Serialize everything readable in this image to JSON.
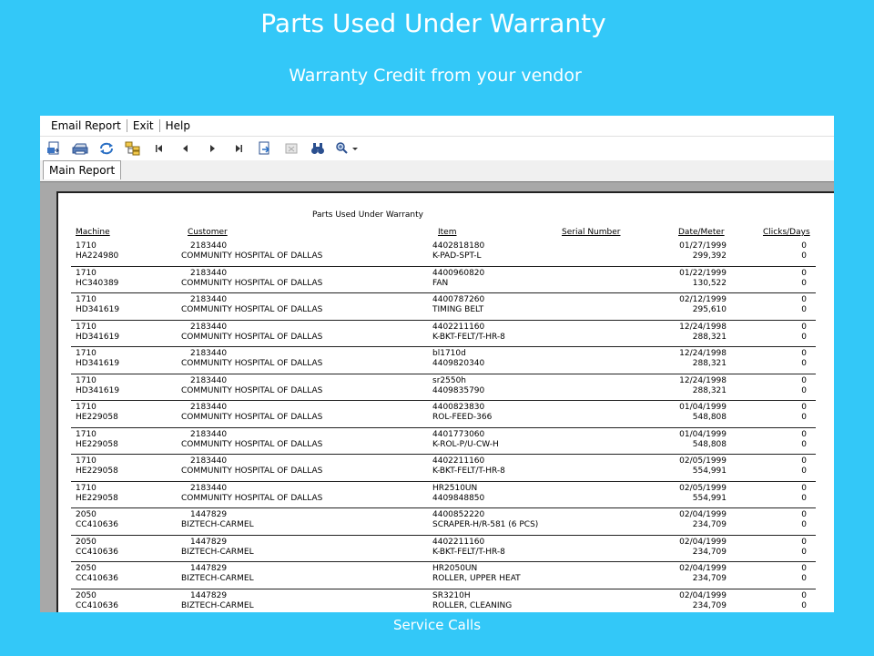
{
  "slide": {
    "title": "Parts Used Under Warranty",
    "subtitle": "Warranty Credit from your vendor",
    "footer": "Service Calls"
  },
  "menu": {
    "items": [
      "Email Report",
      "Exit",
      "Help"
    ]
  },
  "toolbar": {
    "buttons": [
      {
        "name": "export-icon"
      },
      {
        "name": "print-icon"
      },
      {
        "name": "refresh-icon"
      },
      {
        "name": "group-tree-icon"
      },
      {
        "name": "first-page-icon"
      },
      {
        "name": "previous-page-icon"
      },
      {
        "name": "next-page-icon"
      },
      {
        "name": "last-page-icon"
      },
      {
        "name": "goto-page-icon"
      },
      {
        "name": "close-view-icon"
      },
      {
        "name": "binoculars-search-icon"
      },
      {
        "name": "zoom-icon"
      }
    ]
  },
  "tabs": [
    "Main Report"
  ],
  "report": {
    "title": "Parts Used Under Warranty",
    "columns": {
      "machine": "Machine",
      "customer": "Customer",
      "item": "Item",
      "serial": "Serial Number",
      "date_meter": "Date/Meter",
      "clicks_days": "Clicks/Days"
    },
    "rows": [
      {
        "machine": "1710",
        "serial_no": "HA224980",
        "cust_no": "2183440",
        "customer": "COMMUNITY HOSPITAL OF DALLAS",
        "item1": "4402818180",
        "item2": "K-PAD-SPT-L",
        "date": "01/27/1999",
        "meter": "299,392",
        "clicks": "0",
        "days": "0"
      },
      {
        "machine": "1710",
        "serial_no": "HC340389",
        "cust_no": "2183440",
        "customer": "COMMUNITY HOSPITAL OF DALLAS",
        "item1": "4400960820",
        "item2": "FAN",
        "date": "01/22/1999",
        "meter": "130,522",
        "clicks": "0",
        "days": "0"
      },
      {
        "machine": "1710",
        "serial_no": "HD341619",
        "cust_no": "2183440",
        "customer": "COMMUNITY HOSPITAL OF DALLAS",
        "item1": "4400787260",
        "item2": "TIMING BELT",
        "date": "02/12/1999",
        "meter": "295,610",
        "clicks": "0",
        "days": "0"
      },
      {
        "machine": "1710",
        "serial_no": "HD341619",
        "cust_no": "2183440",
        "customer": "COMMUNITY HOSPITAL OF DALLAS",
        "item1": "4402211160",
        "item2": "K-BKT-FELT/T-HR-8",
        "date": "12/24/1998",
        "meter": "288,321",
        "clicks": "0",
        "days": "0"
      },
      {
        "machine": "1710",
        "serial_no": "HD341619",
        "cust_no": "2183440",
        "customer": "COMMUNITY HOSPITAL OF DALLAS",
        "item1": "bl1710d",
        "item2": "4409820340",
        "date": "12/24/1998",
        "meter": "288,321",
        "clicks": "0",
        "days": "0"
      },
      {
        "machine": "1710",
        "serial_no": "HD341619",
        "cust_no": "2183440",
        "customer": "COMMUNITY HOSPITAL OF DALLAS",
        "item1": "sr2550h",
        "item2": "4409835790",
        "date": "12/24/1998",
        "meter": "288,321",
        "clicks": "0",
        "days": "0"
      },
      {
        "machine": "1710",
        "serial_no": "HE229058",
        "cust_no": "2183440",
        "customer": "COMMUNITY HOSPITAL OF DALLAS",
        "item1": "4400823830",
        "item2": "ROL-FEED-366",
        "date": "01/04/1999",
        "meter": "548,808",
        "clicks": "0",
        "days": "0"
      },
      {
        "machine": "1710",
        "serial_no": "HE229058",
        "cust_no": "2183440",
        "customer": "COMMUNITY HOSPITAL OF DALLAS",
        "item1": "4401773060",
        "item2": "K-ROL-P/U-CW-H",
        "date": "01/04/1999",
        "meter": "548,808",
        "clicks": "0",
        "days": "0"
      },
      {
        "machine": "1710",
        "serial_no": "HE229058",
        "cust_no": "2183440",
        "customer": "COMMUNITY HOSPITAL OF DALLAS",
        "item1": "4402211160",
        "item2": "K-BKT-FELT/T-HR-8",
        "date": "02/05/1999",
        "meter": "554,991",
        "clicks": "0",
        "days": "0"
      },
      {
        "machine": "1710",
        "serial_no": "HE229058",
        "cust_no": "2183440",
        "customer": "COMMUNITY HOSPITAL OF DALLAS",
        "item1": "HR2510UN",
        "item2": "4409848850",
        "date": "02/05/1999",
        "meter": "554,991",
        "clicks": "0",
        "days": "0"
      },
      {
        "machine": "2050",
        "serial_no": "CC410636",
        "cust_no": "1447829",
        "customer": "BIZTECH-CARMEL",
        "item1": "4400852220",
        "item2": "SCRAPER-H/R-581 (6 PCS)",
        "date": "02/04/1999",
        "meter": "234,709",
        "clicks": "0",
        "days": "0"
      },
      {
        "machine": "2050",
        "serial_no": "CC410636",
        "cust_no": "1447829",
        "customer": "BIZTECH-CARMEL",
        "item1": "4402211160",
        "item2": "K-BKT-FELT/T-HR-8",
        "date": "02/04/1999",
        "meter": "234,709",
        "clicks": "0",
        "days": "0"
      },
      {
        "machine": "2050",
        "serial_no": "CC410636",
        "cust_no": "1447829",
        "customer": "BIZTECH-CARMEL",
        "item1": "HR2050UN",
        "item2": "ROLLER, UPPER HEAT",
        "date": "02/04/1999",
        "meter": "234,709",
        "clicks": "0",
        "days": "0"
      },
      {
        "machine": "2050",
        "serial_no": "CC410636",
        "cust_no": "1447829",
        "customer": "BIZTECH-CARMEL",
        "item1": "SR3210H",
        "item2": "ROLLER, CLEANING",
        "date": "02/04/1999",
        "meter": "234,709",
        "clicks": "0",
        "days": "0"
      }
    ]
  }
}
